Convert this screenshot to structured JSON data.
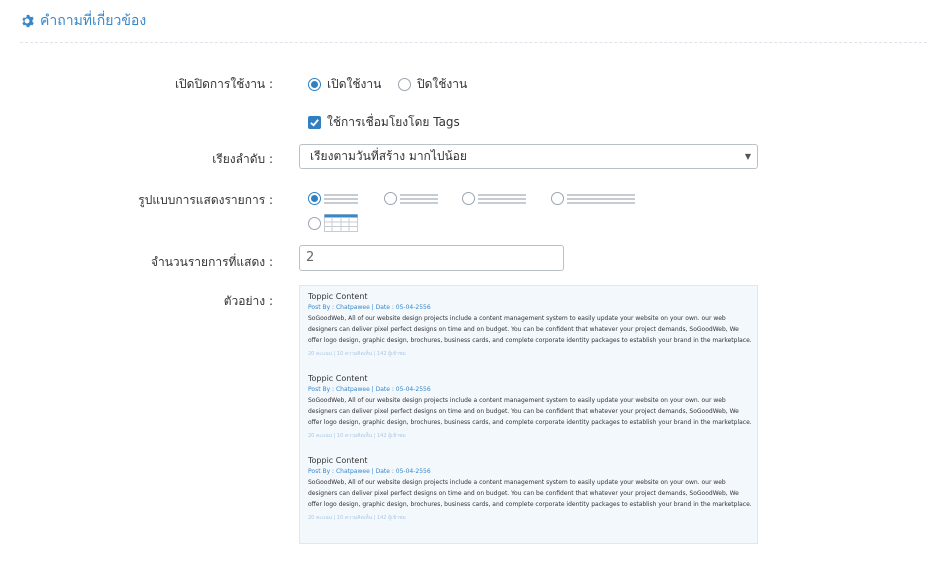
{
  "header": {
    "title": "คำถามที่เกี่ยวข้อง",
    "accent": "#3a87c8"
  },
  "form": {
    "status": {
      "label": "เปิดปิดการใช้งาน :",
      "options": [
        "เปิดใช้งาน",
        "ปิดใช้งาน"
      ],
      "selected": "เปิดใช้งาน"
    },
    "tags": {
      "label": "ใช้การเชื่อมโยงโดย Tags",
      "checked": true
    },
    "sort": {
      "label": "เรียงลำดับ :",
      "value": "เรียงตามวันที่สร้าง มากไปน้อย"
    },
    "display": {
      "label": "รูปแบบการแสดงรายการ :",
      "options": [
        "list-1",
        "list-2",
        "list-3",
        "list-4",
        "table"
      ],
      "selected": "list-1"
    },
    "count": {
      "label": "จำนวนรายการที่แสดง :",
      "value": "2"
    },
    "example": {
      "label": "ตัวอย่าง :"
    }
  },
  "preview": {
    "posts": [
      {
        "title": "Toppic Content",
        "meta": "Post By : Chatpawee  |  Date : 05-04-2556",
        "body": "SoGoodWeb, All of our website design projects include a content management system to easily update your website on your own. our web designers can deliver pixel perfect designs on time and on budget. You can be confident that whatever your project demands, SoGoodWeb, We offer logo design, graphic design, brochures, business cards, and complete corporate identity packages to establish your brand in the marketplace. Helping you to stand out among",
        "stats": "20 คะแนน | 10 ความคิดเห็น | 142 ผู้เข้าชม"
      },
      {
        "title": "Toppic Content",
        "meta": "Post By : Chatpawee  |  Date : 05-04-2556",
        "body": "SoGoodWeb, All of our website design projects include a content management system to easily update your website on your own. our web designers can deliver pixel perfect designs on time and on budget. You can be confident that whatever your project demands, SoGoodWeb, We offer logo design, graphic design, brochures, business cards, and complete corporate identity packages to establish your brand in the marketplace. Helping you to stand out among",
        "stats": "20 คะแนน | 10 ความคิดเห็น | 142 ผู้เข้าชม"
      },
      {
        "title": "Toppic Content",
        "meta": "Post By : Chatpawee  |  Date : 05-04-2556",
        "body": "SoGoodWeb, All of our website design projects include a content management system to easily update your website on your own. our web designers can deliver pixel perfect designs on time and on budget. You can be confident that whatever your project demands, SoGoodWeb, We offer logo design, graphic design, brochures, business cards, and complete corporate identity packages to establish your brand in the marketplace. Helping you to stand out among",
        "stats": "20 คะแนน | 10 ความคิดเห็น | 142 ผู้เข้าชม"
      }
    ]
  }
}
